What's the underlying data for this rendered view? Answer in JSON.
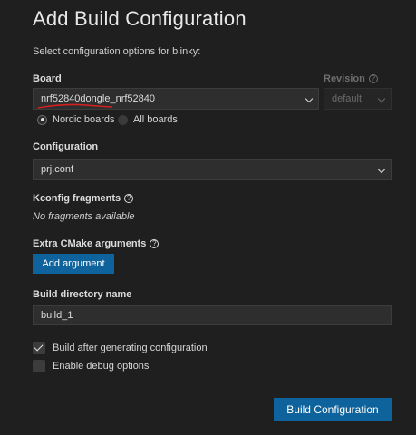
{
  "header": {
    "title": "Add Build Configuration",
    "subtitle": "Select configuration options for blinky:"
  },
  "board": {
    "label": "Board",
    "value": "nrf52840dongle_nrf52840",
    "radio_nordic": "Nordic boards",
    "radio_all": "All boards",
    "selected_filter": "Nordic boards"
  },
  "revision": {
    "label": "Revision",
    "value": "default"
  },
  "configuration": {
    "label": "Configuration",
    "value": "prj.conf"
  },
  "kconfig": {
    "label": "Kconfig fragments",
    "empty_text": "No fragments available"
  },
  "cmake": {
    "label": "Extra CMake arguments",
    "add_button": "Add argument"
  },
  "build_dir": {
    "label": "Build directory name",
    "value": "build_1"
  },
  "options": {
    "build_after": "Build after generating configuration",
    "build_after_checked": true,
    "debug": "Enable debug options",
    "debug_checked": false
  },
  "footer": {
    "submit_button": "Build Configuration"
  },
  "colors": {
    "accent": "#0e639c",
    "annotation": "#d42020"
  },
  "icons": {
    "help": "question-circle-icon",
    "dropdown": "chevron-down-icon",
    "check": "check-icon"
  }
}
